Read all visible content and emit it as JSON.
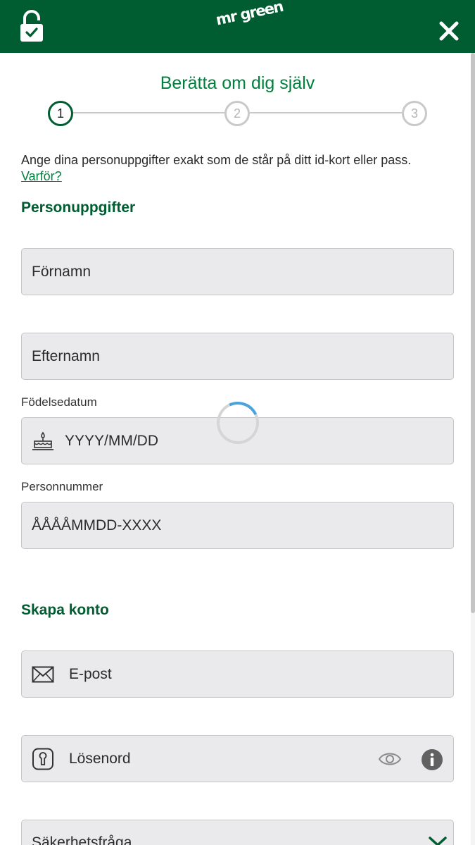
{
  "header": {
    "logo_text": "mr green",
    "colors": {
      "brand": "#005c31",
      "accent": "#00803e"
    }
  },
  "stepper": {
    "title": "Berätta om dig själv",
    "steps": [
      "1",
      "2",
      "3"
    ],
    "active_step": 1
  },
  "intro": {
    "text": "Ange dina personuppgifter exakt som de står på ditt id-kort eller pass.",
    "link": "Varför?"
  },
  "personal": {
    "heading": "Personuppgifter",
    "first_name_placeholder": "Förnamn",
    "last_name_placeholder": "Efternamn",
    "dob_label": "Födelsedatum",
    "dob_placeholder": "YYYY/MM/DD",
    "pnr_label": "Personnummer",
    "pnr_placeholder": "ÅÅÅÅMMDD-XXXX"
  },
  "account": {
    "heading": "Skapa konto",
    "email_placeholder": "E-post",
    "password_placeholder": "Lösenord",
    "security_question": "Säkerhetsfråga"
  },
  "icons": {
    "header_left": "lock-check-icon",
    "header_right": "close-icon",
    "dob": "cake-icon",
    "email": "envelope-icon",
    "password": "keyhole-icon",
    "password_toggle": "eye-icon",
    "password_info": "info-icon",
    "select": "chevron-down-icon"
  }
}
